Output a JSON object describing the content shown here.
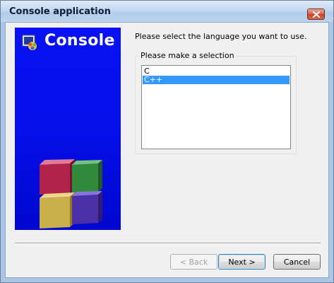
{
  "window": {
    "title": "Console application"
  },
  "banner": {
    "title": "Console"
  },
  "main": {
    "prompt": "Please select the language you want to use.",
    "group_label": "Please make a selection",
    "languages": [
      {
        "label": "C",
        "selected": false
      },
      {
        "label": "C++",
        "selected": true
      }
    ]
  },
  "buttons": {
    "back": "< Back",
    "next": "Next >",
    "cancel": "Cancel"
  },
  "colors": {
    "banner_blue": "#0510ea",
    "selection": "#3399ff",
    "close_button": "#d9604a"
  },
  "icons": {
    "logo": "codeblocks-logo-icon",
    "close": "close-icon",
    "cubes": "cubes-icon"
  }
}
